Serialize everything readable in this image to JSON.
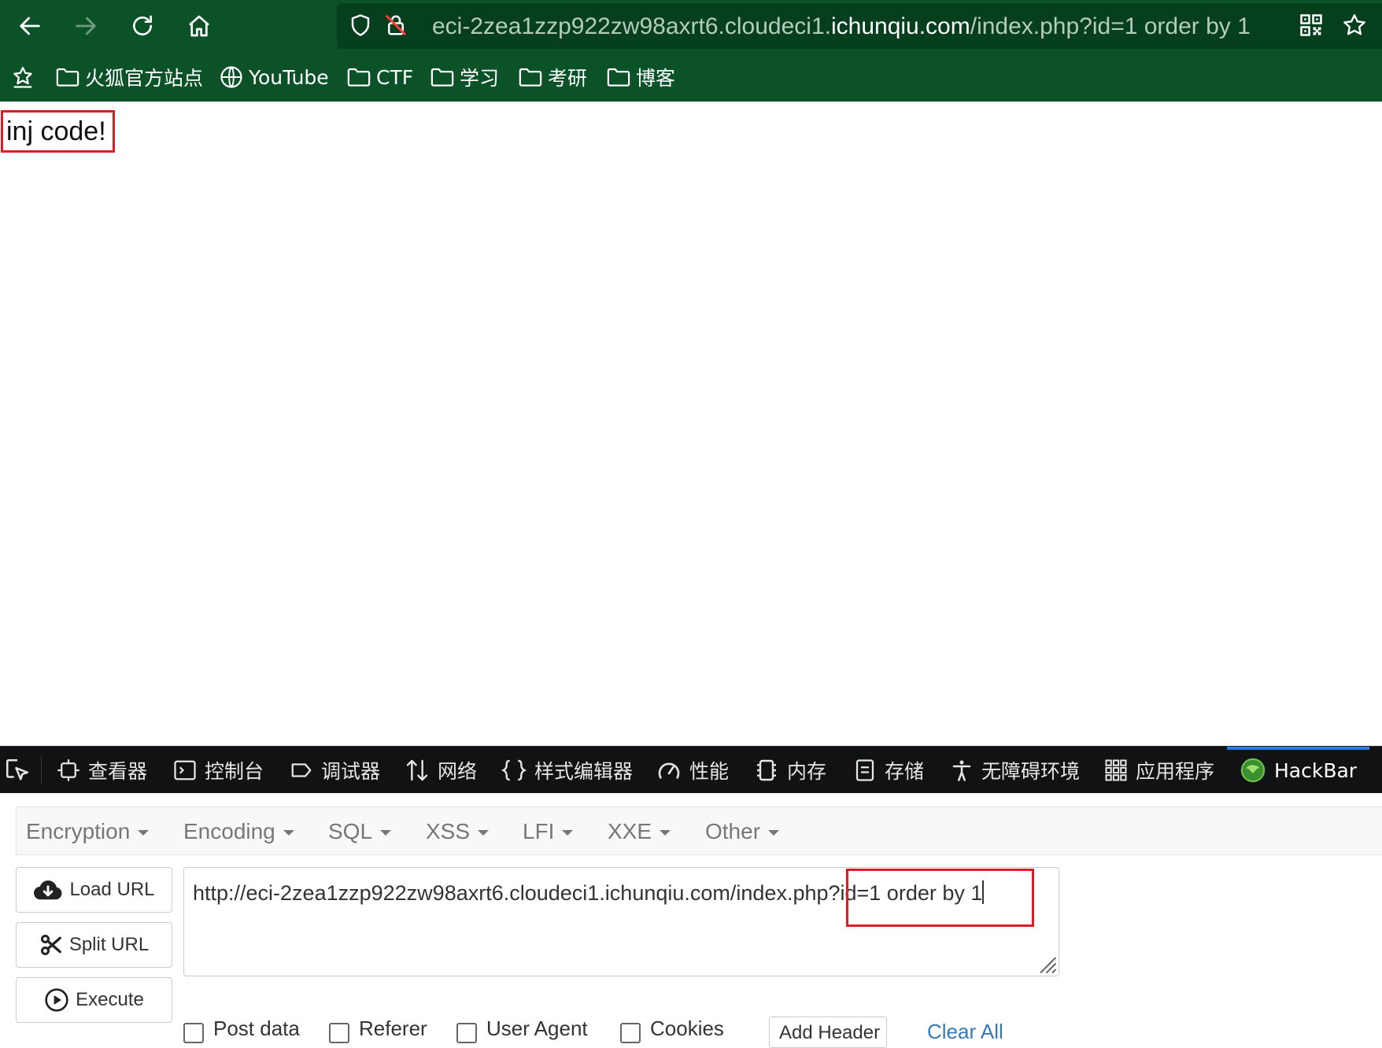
{
  "browser": {
    "url": {
      "prefix": "eci-2zea1zzp922zw98axrt6.cloudeci1.",
      "domain": "ichunqiu.com",
      "suffix": "/index.php?id=1 order by 1"
    },
    "bookmarks": [
      {
        "label": "火狐官方站点",
        "icon": "folder-icon"
      },
      {
        "label": "YouTube",
        "icon": "globe-icon"
      },
      {
        "label": "CTF",
        "icon": "folder-icon"
      },
      {
        "label": "学习",
        "icon": "folder-icon"
      },
      {
        "label": "考研",
        "icon": "folder-icon"
      },
      {
        "label": "博客",
        "icon": "folder-icon"
      }
    ]
  },
  "page": {
    "text": "inj code!"
  },
  "devtools": {
    "tabs": [
      {
        "label": "查看器",
        "icon": "inspector-icon"
      },
      {
        "label": "控制台",
        "icon": "console-icon"
      },
      {
        "label": "调试器",
        "icon": "debugger-icon"
      },
      {
        "label": "网络",
        "icon": "network-icon"
      },
      {
        "label": "样式编辑器",
        "icon": "style-editor-icon"
      },
      {
        "label": "性能",
        "icon": "performance-icon"
      },
      {
        "label": "内存",
        "icon": "memory-icon"
      },
      {
        "label": "存储",
        "icon": "storage-icon"
      },
      {
        "label": "无障碍环境",
        "icon": "accessibility-icon"
      },
      {
        "label": "应用程序",
        "icon": "application-icon"
      },
      {
        "label": "HackBar",
        "icon": "hackbar-icon",
        "active": true
      }
    ]
  },
  "hackbar": {
    "menu": [
      "Encryption",
      "Encoding",
      "SQL",
      "XSS",
      "LFI",
      "XXE",
      "Other"
    ],
    "buttons": {
      "load_url": "Load URL",
      "split_url": "Split URL",
      "execute": "Execute"
    },
    "url_value": "http://eci-2zea1zzp922zw98axrt6.cloudeci1.ichunqiu.com/index.php?id=1 order by 1",
    "options": [
      "Post data",
      "Referer",
      "User Agent",
      "Cookies"
    ],
    "add_header": "Add Header",
    "clear_all": "Clear All"
  },
  "colors": {
    "toolbar_bg": "#0b5229",
    "urlbar_bg": "#063f1d",
    "highlight": "#e01b24",
    "devtools_bg": "#111214",
    "active_tab_accent": "#2c7be5"
  }
}
